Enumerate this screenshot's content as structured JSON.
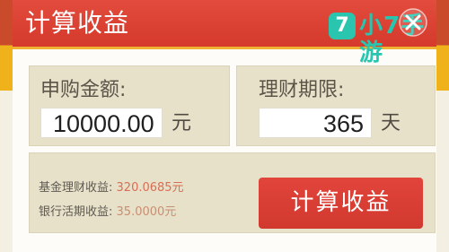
{
  "dialog": {
    "title": "计算收益"
  },
  "watermark": {
    "badge": "7",
    "text": "小7手游"
  },
  "amount": {
    "label": "申购金额:",
    "value": "10000.00",
    "unit": "元"
  },
  "period": {
    "label": "理财期限:",
    "value": "365",
    "unit": "天"
  },
  "results": {
    "fund_label": "基金理财收益:",
    "fund_value": "320.0685元",
    "bank_label": "银行活期收益:",
    "bank_value": "35.0000元"
  },
  "button": {
    "label": "计算收益"
  },
  "icons": {
    "close": "close-icon",
    "watermark": "app-logo-icon"
  },
  "colors": {
    "header": "#d53a2c",
    "accent": "#f0b233",
    "card": "#e8e1ca",
    "button": "#d1392f",
    "watermark": "#26c6b0"
  }
}
